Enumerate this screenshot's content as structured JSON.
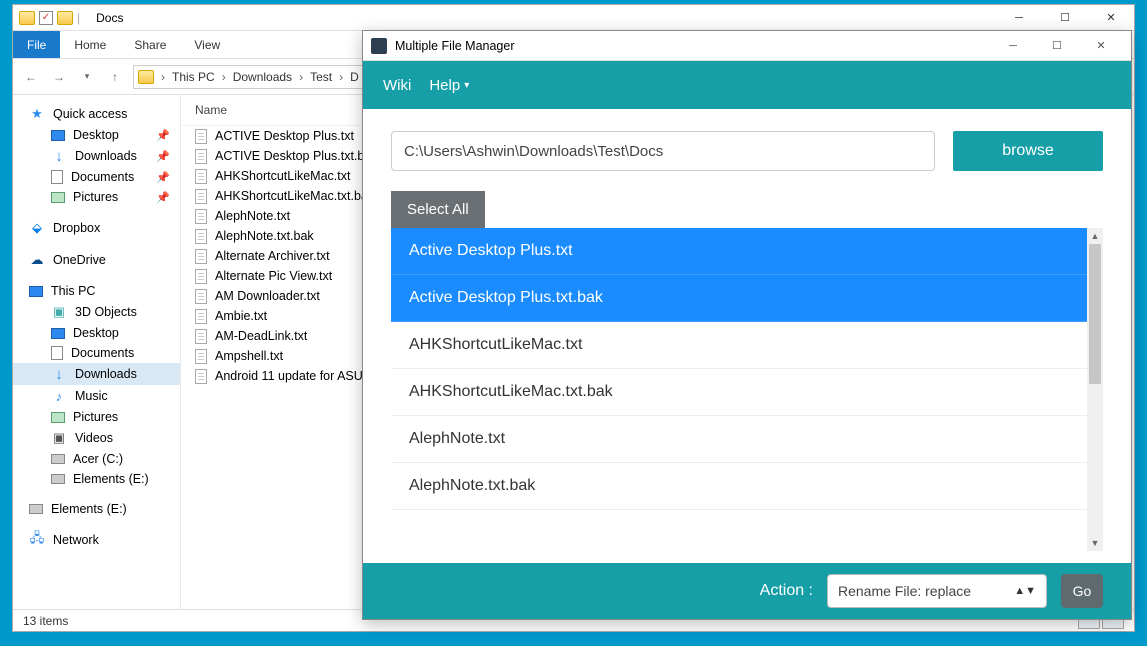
{
  "explorer": {
    "title": "Docs",
    "tabs": {
      "file": "File",
      "home": "Home",
      "share": "Share",
      "view": "View"
    },
    "breadcrumb": [
      "This PC",
      "Downloads",
      "Test",
      "D"
    ],
    "nav": {
      "quick_access": "Quick access",
      "desktop": "Desktop",
      "downloads": "Downloads",
      "documents": "Documents",
      "pictures": "Pictures",
      "dropbox": "Dropbox",
      "onedrive": "OneDrive",
      "this_pc": "This PC",
      "objects3d": "3D Objects",
      "desktop2": "Desktop",
      "documents2": "Documents",
      "downloads2": "Downloads",
      "music": "Music",
      "pictures2": "Pictures",
      "videos": "Videos",
      "acer": "Acer (C:)",
      "elements": "Elements (E:)",
      "elements2": "Elements (E:)",
      "network": "Network"
    },
    "columns": {
      "name": "Name"
    },
    "files": [
      "ACTIVE Desktop Plus.txt",
      "ACTIVE Desktop Plus.txt.ba",
      "AHKShortcutLikeMac.txt",
      "AHKShortcutLikeMac.txt.ba",
      "AlephNote.txt",
      "AlephNote.txt.bak",
      "Alternate Archiver.txt",
      "Alternate Pic View.txt",
      "AM Downloader.txt",
      "Ambie.txt",
      "AM-DeadLink.txt",
      "Ampshell.txt",
      "Android 11 update for ASU"
    ],
    "status": "13 items"
  },
  "mfm": {
    "title": "Multiple File Manager",
    "menu": {
      "wiki": "Wiki",
      "help": "Help"
    },
    "path": "C:\\Users\\Ashwin\\Downloads\\Test\\Docs",
    "browse": "browse",
    "select_all": "Select All",
    "list": [
      {
        "name": "Active Desktop Plus.txt",
        "selected": true
      },
      {
        "name": "Active Desktop Plus.txt.bak",
        "selected": true
      },
      {
        "name": "AHKShortcutLikeMac.txt",
        "selected": false
      },
      {
        "name": "AHKShortcutLikeMac.txt.bak",
        "selected": false
      },
      {
        "name": "AlephNote.txt",
        "selected": false
      },
      {
        "name": "AlephNote.txt.bak",
        "selected": false
      }
    ],
    "action_label": "Action :",
    "action_value": "Rename File: replace",
    "go": "Go"
  }
}
